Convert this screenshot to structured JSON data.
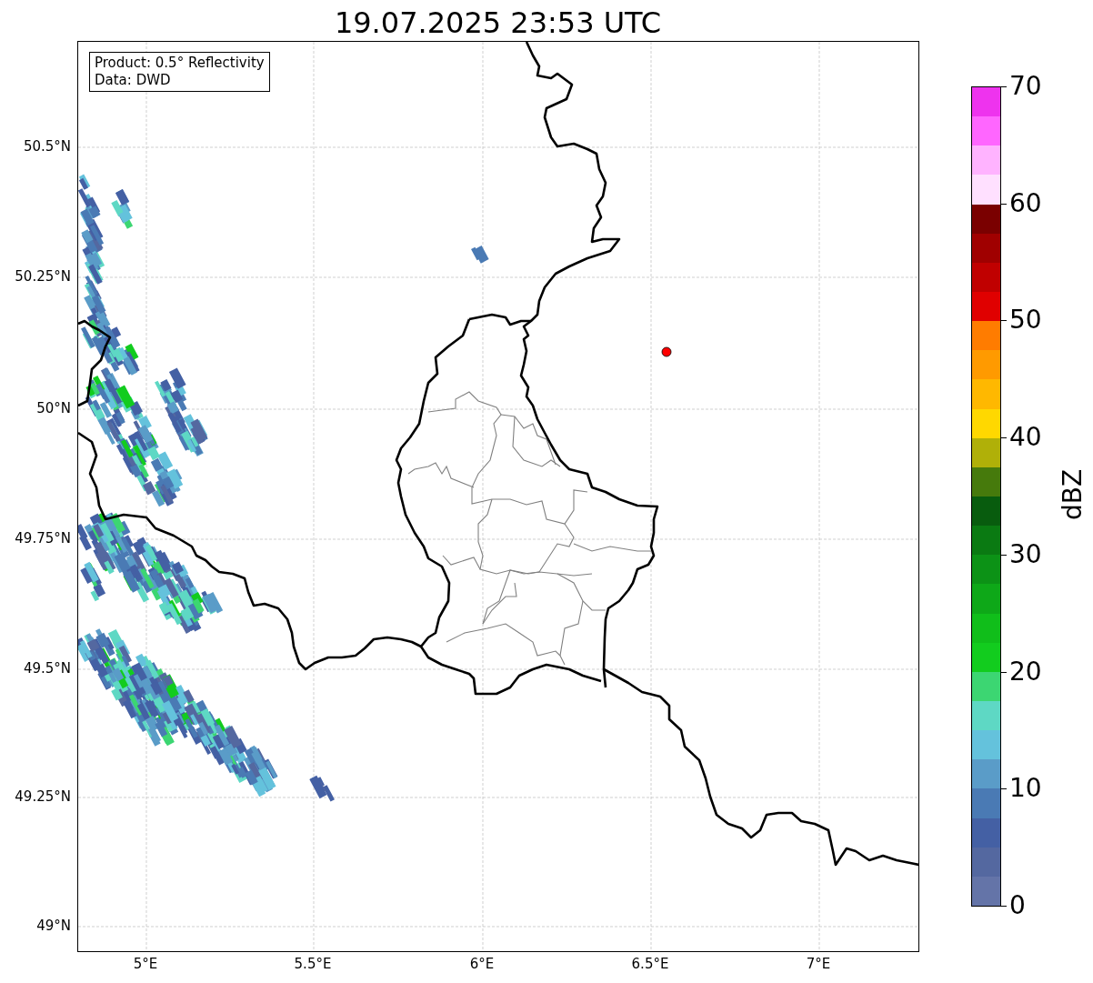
{
  "title": "19.07.2025 23:53 UTC",
  "info_box": {
    "lines": [
      "Product: 0.5° Reflectivity",
      "Data: DWD"
    ]
  },
  "map": {
    "latitude_labels": [
      "50.5°N",
      "50.25°N",
      "50°N",
      "49.75°N",
      "49.5°N",
      "49.25°N",
      "49°N"
    ],
    "longitude_labels": [
      "5°E",
      "5.5°E",
      "6°E",
      "6.5°E",
      "7°E"
    ]
  },
  "colorbar": {
    "label": "dBZ",
    "ticks": [
      "70",
      "60",
      "50",
      "40",
      "30",
      "20",
      "10",
      "0"
    ],
    "steps": [
      {
        "color": "#6474a8"
      },
      {
        "color": "#5468a0"
      },
      {
        "color": "#4460a4"
      },
      {
        "color": "#4a7ab4"
      },
      {
        "color": "#5a9cc8"
      },
      {
        "color": "#64c2dc"
      },
      {
        "color": "#5ed8c4"
      },
      {
        "color": "#3cd672"
      },
      {
        "color": "#12cc1e"
      },
      {
        "color": "#10be1a"
      },
      {
        "color": "#0ea818"
      },
      {
        "color": "#0c9216"
      },
      {
        "color": "#0a7a12"
      },
      {
        "color": "#085c0e"
      },
      {
        "color": "#467a0c"
      },
      {
        "color": "#b0b008"
      },
      {
        "color": "#ffd800"
      },
      {
        "color": "#ffb800"
      },
      {
        "color": "#ff9a00"
      },
      {
        "color": "#ff7c00"
      },
      {
        "color": "#e00000"
      },
      {
        "color": "#c00000"
      },
      {
        "color": "#a00000"
      },
      {
        "color": "#7a0000"
      },
      {
        "color": "#ffe0ff"
      },
      {
        "color": "#ffb3ff"
      },
      {
        "color": "#ff66ff"
      },
      {
        "color": "#ee33ee"
      }
    ]
  }
}
